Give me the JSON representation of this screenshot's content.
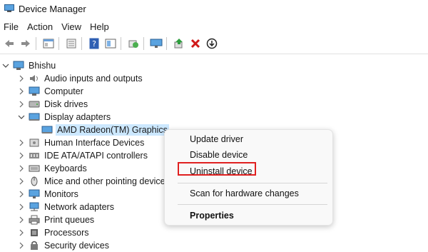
{
  "window": {
    "title": "Device Manager"
  },
  "menu": [
    "File",
    "Action",
    "View",
    "Help"
  ],
  "toolbar": {
    "icons": [
      "back-arrow-icon",
      "forward-arrow-icon",
      "properties-icon",
      "sheet-icon",
      "help-icon",
      "view-icon",
      "scan-icon",
      "monitor-icon",
      "update-driver-icon",
      "uninstall-icon",
      "download-icon"
    ]
  },
  "tree": {
    "root": "Bhishu",
    "items": [
      {
        "label": "Audio inputs and outputs",
        "icon": "speaker-icon",
        "expanded": false
      },
      {
        "label": "Computer",
        "icon": "computer-icon",
        "expanded": false
      },
      {
        "label": "Disk drives",
        "icon": "disk-icon",
        "expanded": false
      },
      {
        "label": "Display adapters",
        "icon": "display-icon",
        "expanded": true
      },
      {
        "label": "AMD Radeon(TM) Graphics",
        "icon": "display-icon",
        "child": true,
        "selected": true
      },
      {
        "label": "Human Interface Devices",
        "icon": "hid-icon",
        "expanded": false
      },
      {
        "label": "IDE ATA/ATAPI controllers",
        "icon": "ide-icon",
        "expanded": false
      },
      {
        "label": "Keyboards",
        "icon": "keyboard-icon",
        "expanded": false
      },
      {
        "label": "Mice and other pointing device",
        "icon": "mouse-icon",
        "expanded": false
      },
      {
        "label": "Monitors",
        "icon": "monitor-icon",
        "expanded": false
      },
      {
        "label": "Network adapters",
        "icon": "network-icon",
        "expanded": false
      },
      {
        "label": "Print queues",
        "icon": "printer-icon",
        "expanded": false
      },
      {
        "label": "Processors",
        "icon": "processor-icon",
        "expanded": false
      },
      {
        "label": "Security devices",
        "icon": "security-icon",
        "expanded": false
      }
    ]
  },
  "context_menu": {
    "update": "Update driver",
    "disable": "Disable device",
    "uninstall": "Uninstall device",
    "scan": "Scan for hardware changes",
    "properties": "Properties"
  },
  "colors": {
    "selection": "#cce8ff",
    "highlight": "#e02020"
  }
}
